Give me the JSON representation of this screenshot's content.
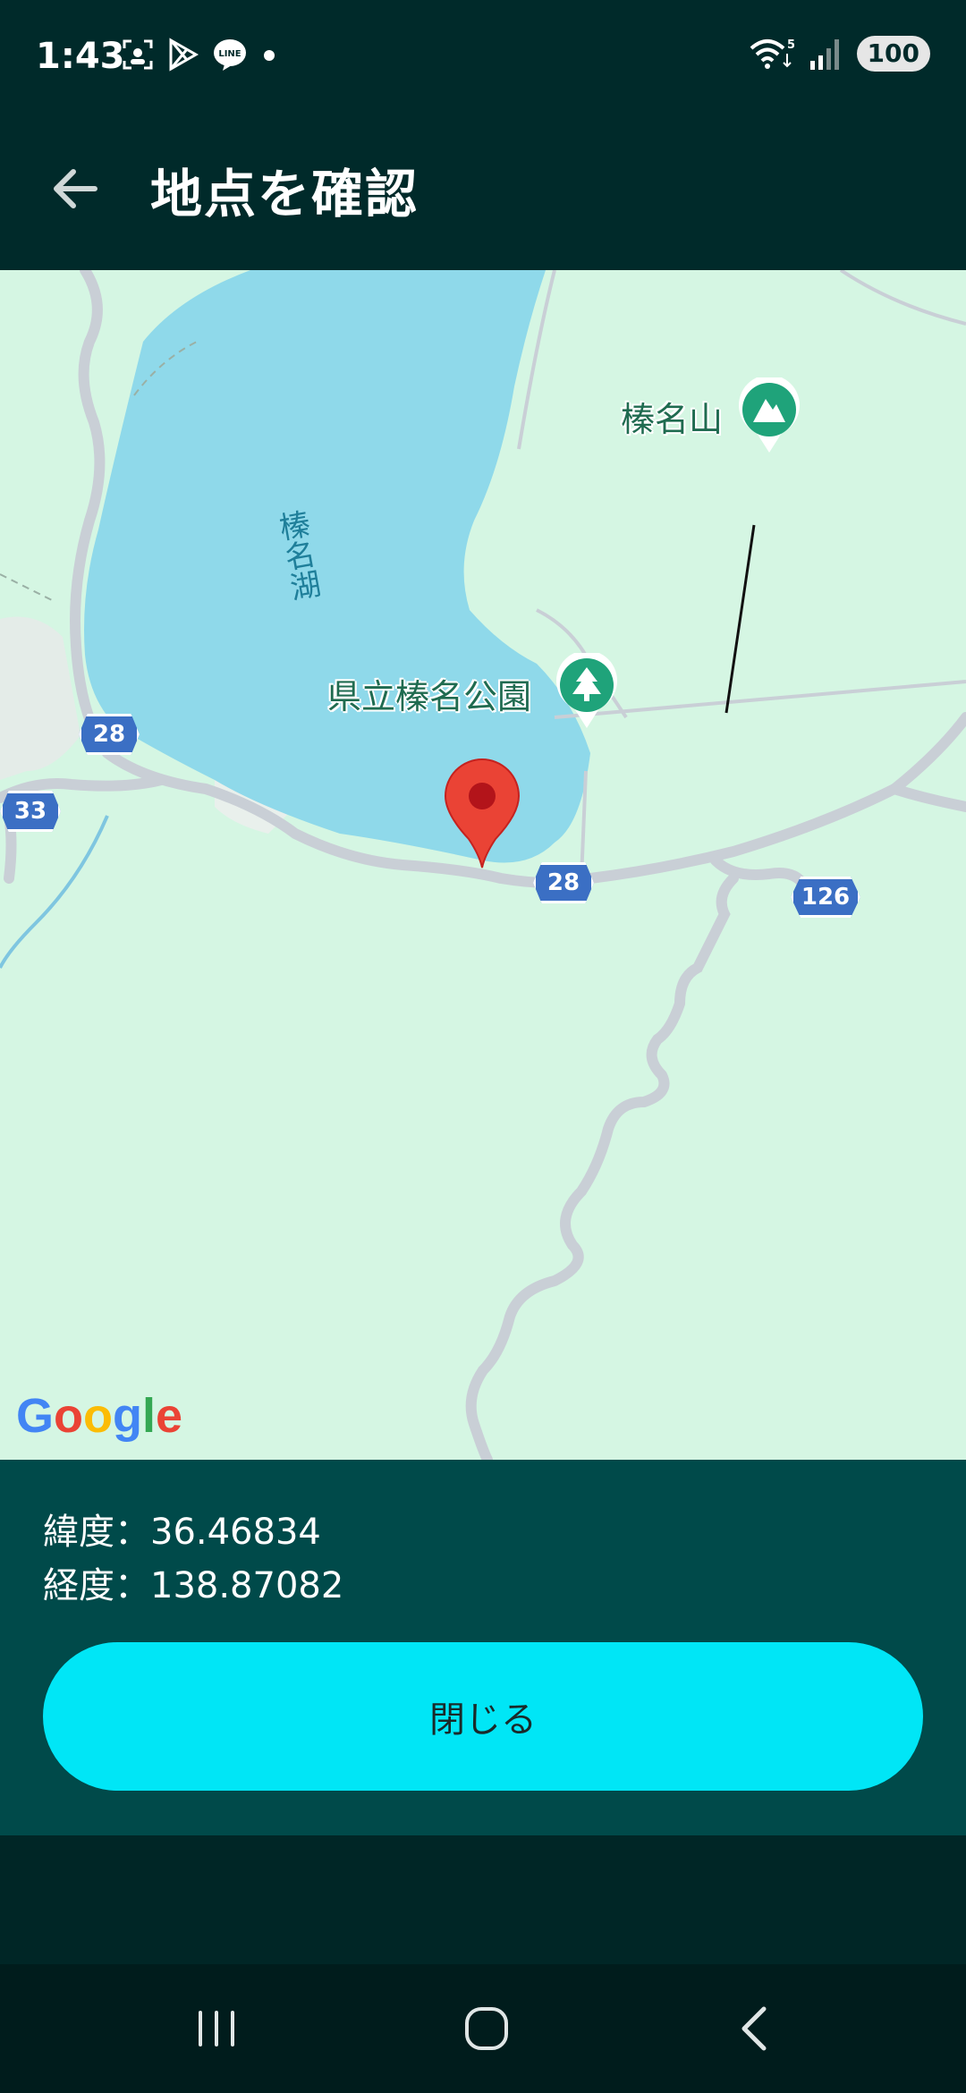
{
  "status_bar": {
    "time": "1:43",
    "battery": "100",
    "left_icons": [
      "screenshot-icon",
      "play-store-icon",
      "line-icon",
      "dot-icon"
    ],
    "right_icons": [
      "wifi-icon",
      "signal-icon",
      "battery-icon"
    ]
  },
  "app_bar": {
    "title": "地点を確認",
    "back_icon": "arrow-back-icon"
  },
  "map": {
    "lake_label": "榛名湖",
    "labels": {
      "mountain": "榛名山",
      "park": "県立榛名公園"
    },
    "routes": {
      "r28a": "28",
      "r28b": "28",
      "r33": "33",
      "r126": "126"
    },
    "provider": "Google",
    "colors": {
      "land": "#d5f6e3",
      "water": "#8fd9ea",
      "road": "#c9cfd6",
      "marker": "#ea4335",
      "poi": "#1fa37a"
    }
  },
  "info": {
    "latitude": "緯度：36.46834",
    "longitude": "経度：138.87082",
    "close_label": "閉じる",
    "button_color": "#00e6f6"
  },
  "nav_bar": {
    "buttons": [
      "recents-icon",
      "home-icon",
      "back-icon"
    ]
  }
}
